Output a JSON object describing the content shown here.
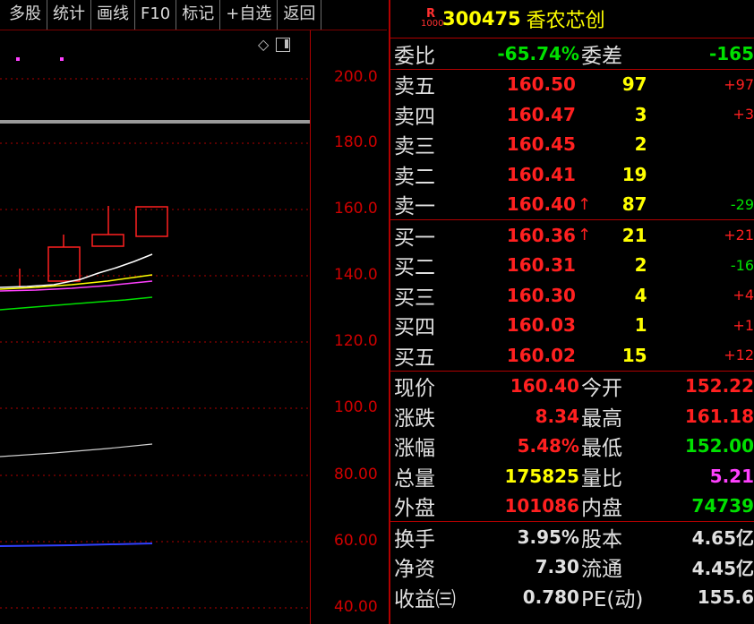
{
  "toolbar": {
    "buttons": [
      "多股",
      "统计",
      "画线",
      "F10",
      "标记",
      "+自选",
      "返回"
    ]
  },
  "chart": {
    "y_ticks": [
      "200.0",
      "180.0",
      "160.0",
      "140.0",
      "120.0",
      "100.0",
      "80.00",
      "60.00",
      "40.00"
    ],
    "icons": [
      "diamond-icon",
      "window-toggle-icon"
    ]
  },
  "header": {
    "badge_top": "R",
    "badge_bottom": "1000",
    "code": "300475",
    "name": "香农芯创"
  },
  "ratio": {
    "label": "委比",
    "value": "-65.74%",
    "diff_label": "委差",
    "diff_value": "-165"
  },
  "asks": [
    {
      "label": "卖五",
      "price": "160.50",
      "arrow": "",
      "vol": "97",
      "chg": "+97"
    },
    {
      "label": "卖四",
      "price": "160.47",
      "arrow": "",
      "vol": "3",
      "chg": "+3"
    },
    {
      "label": "卖三",
      "price": "160.45",
      "arrow": "",
      "vol": "2",
      "chg": ""
    },
    {
      "label": "卖二",
      "price": "160.41",
      "arrow": "",
      "vol": "19",
      "chg": ""
    },
    {
      "label": "卖一",
      "price": "160.40",
      "arrow": "↑",
      "vol": "87",
      "chg": "-29"
    }
  ],
  "bids": [
    {
      "label": "买一",
      "price": "160.36",
      "arrow": "↑",
      "vol": "21",
      "chg": "+21"
    },
    {
      "label": "买二",
      "price": "160.31",
      "arrow": "",
      "vol": "2",
      "chg": "-16"
    },
    {
      "label": "买三",
      "price": "160.30",
      "arrow": "",
      "vol": "4",
      "chg": "+4"
    },
    {
      "label": "买四",
      "price": "160.03",
      "arrow": "",
      "vol": "1",
      "chg": "+1"
    },
    {
      "label": "买五",
      "price": "160.02",
      "arrow": "",
      "vol": "15",
      "chg": "+12"
    }
  ],
  "quote": [
    {
      "l1": "现价",
      "v1": "160.40",
      "c1": "red",
      "l2": "今开",
      "v2": "152.22",
      "c2": "red"
    },
    {
      "l1": "涨跌",
      "v1": "8.34",
      "c1": "red",
      "l2": "最高",
      "v2": "161.18",
      "c2": "red"
    },
    {
      "l1": "涨幅",
      "v1": "5.48%",
      "c1": "red",
      "l2": "最低",
      "v2": "152.00",
      "c2": "green"
    },
    {
      "l1": "总量",
      "v1": "175825",
      "c1": "yellow",
      "l2": "量比",
      "v2": "5.21",
      "c2": "magenta"
    },
    {
      "l1": "外盘",
      "v1": "101086",
      "c1": "red",
      "l2": "内盘",
      "v2": "74739",
      "c2": "green"
    }
  ],
  "fundamentals": [
    {
      "l1": "换手",
      "v1": "3.95%",
      "l2": "股本",
      "v2": "4.65亿"
    },
    {
      "l1": "净资",
      "v1": "7.30",
      "l2": "流通",
      "v2": "4.45亿"
    },
    {
      "l1": "收益㈢",
      "v1": "0.780",
      "l2": "PE(动)",
      "v2": "155.6"
    }
  ],
  "colors": {
    "up": "#ff2020",
    "down": "#00e000",
    "grid": "#b00000",
    "ma5": "#ffffff",
    "ma10": "#ffff00",
    "ma20": "#ff40ff",
    "ma60": "#00e000"
  }
}
